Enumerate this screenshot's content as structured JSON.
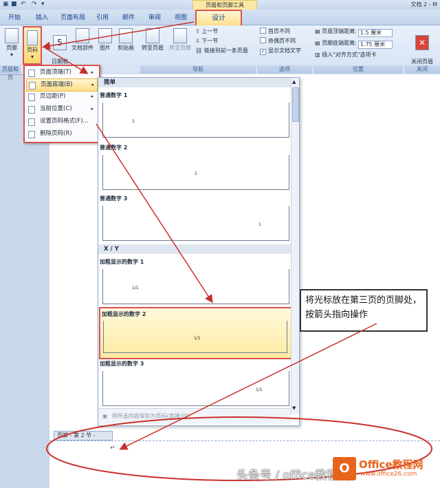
{
  "titlebar": {
    "context_label": "页眉和页脚工具",
    "doc_title": "文档 2 - M"
  },
  "tabs": [
    {
      "label": "开始"
    },
    {
      "label": "插入"
    },
    {
      "label": "页面布局"
    },
    {
      "label": "引用"
    },
    {
      "label": "邮件"
    },
    {
      "label": "审阅"
    },
    {
      "label": "视图"
    }
  ],
  "active_tab": {
    "label": "设计"
  },
  "ribbon": {
    "footer_btn": "页脚",
    "page_btn": "页码",
    "datetime_btn": "日期和\n时间",
    "docparts_btn": "文档部件",
    "picture_btn": "图片",
    "clipart_btn": "剪贴画",
    "goto_header": "转至页眉",
    "goto_footer": "转至页脚",
    "prev_section": "上一节",
    "next_section": "下一节",
    "link_prev": "链接到前一条页眉",
    "opt_first": "首页不同",
    "opt_oddeven": "奇偶页不同",
    "opt_showtext": "显示文档文字",
    "header_dist_label": "页眉顶端距离:",
    "header_dist_value": "1.5 厘米",
    "footer_dist_label": "页脚底端距离:",
    "footer_dist_value": "1.75 厘米",
    "insert_tab_label": "插入\"对齐方式\"选项卡",
    "close_btn": "关闭页眉\n和页脚",
    "groups": {
      "header_footer": "页眉和页",
      "nav": "导航",
      "options": "选项",
      "position": "位置",
      "close": "关闭"
    }
  },
  "menu": {
    "items": [
      {
        "label": "页面顶端(T)"
      },
      {
        "label": "页面底端(B)"
      },
      {
        "label": "页边距(P)"
      },
      {
        "label": "当前位置(C)"
      },
      {
        "label": "设置页码格式(F)..."
      },
      {
        "label": "删除页码(R)"
      }
    ]
  },
  "gallery": {
    "section1": "简单",
    "items1": [
      {
        "label": "普通数字 1",
        "sample": "1"
      },
      {
        "label": "普通数字 2",
        "sample": "1"
      },
      {
        "label": "普通数字 3",
        "sample": "1"
      }
    ],
    "section2": "X / Y",
    "items2": [
      {
        "label": "加粗显示的数字 1",
        "sample": "1/1"
      },
      {
        "label": "加粗显示的数字 2",
        "sample": "1/1"
      },
      {
        "label": "加粗显示的数字 3",
        "sample": "1/1"
      }
    ],
    "footer_text": "将所选内容保存为页码(底端)(S)"
  },
  "document": {
    "footer_tag": "页脚 - 第 2 节 -"
  },
  "callout": {
    "text": "将光标放在第三页的页脚处，按箭头指向操作"
  },
  "watermark": {
    "text": "头条号 / office教程网",
    "brand": "Office教程网",
    "url": "www.office26.com",
    "brand_icon": "O"
  },
  "colors": {
    "annotation_red": "#d9534f",
    "ribbon_blue": "#d5e2f2",
    "brand_orange": "#e8641b"
  }
}
